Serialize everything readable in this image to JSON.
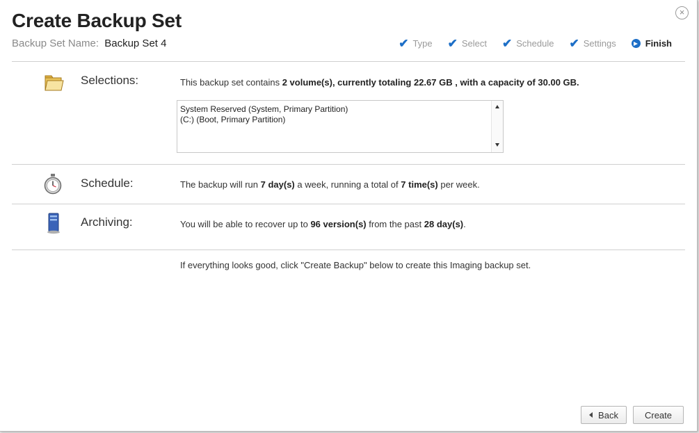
{
  "dialog": {
    "title": "Create Backup Set",
    "close_symbol": "×",
    "set_name_label": "Backup Set Name:",
    "set_name_value": "Backup Set 4"
  },
  "steps": [
    {
      "label": "Type",
      "state": "done"
    },
    {
      "label": "Select",
      "state": "done"
    },
    {
      "label": "Schedule",
      "state": "done"
    },
    {
      "label": "Settings",
      "state": "done"
    },
    {
      "label": "Finish",
      "state": "current"
    }
  ],
  "selections": {
    "icon": "folder-icon",
    "label": "Selections:",
    "text_pre": "This backup set contains",
    "text_bold": "2 volume(s), currently totaling 22.67 GB , with a capacity of 30.00 GB.",
    "volumes": [
      "System Reserved (System, Primary Partition)",
      "(C:) (Boot, Primary Partition)"
    ]
  },
  "schedule": {
    "icon": "stopwatch-icon",
    "label": "Schedule:",
    "t1": "The backup will run",
    "b1": "7 day(s)",
    "t2": "a week, running a total of",
    "b2": "7 time(s)",
    "t3": "per week."
  },
  "archiving": {
    "icon": "server-icon",
    "label": "Archiving:",
    "t1": "You will be able to recover up to",
    "b1": "96 version(s)",
    "t2": "from the past",
    "b2": "28 day(s)",
    "t3": "."
  },
  "footer_note": "If everything looks good, click \"Create Backup\" below to create this Imaging backup set.",
  "buttons": {
    "back": "Back",
    "create": "Create"
  },
  "colors": {
    "accent": "#1d6fc7",
    "divider": "#cfcfcf"
  }
}
